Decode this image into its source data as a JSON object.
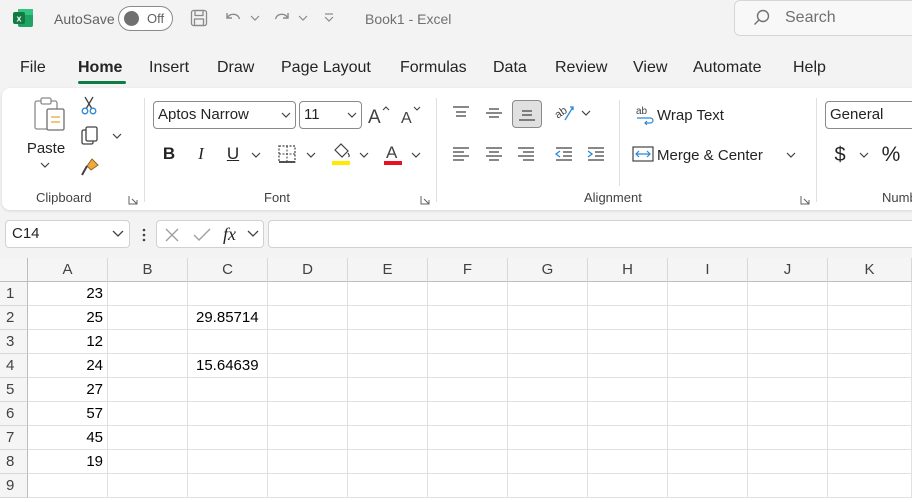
{
  "titlebar": {
    "autosave_label": "AutoSave",
    "toggle_state": "Off",
    "document_title": "Book1  -  Excel",
    "search_placeholder": "Search",
    "icons": [
      "excel-app-icon",
      "save-icon",
      "undo-icon",
      "redo-icon",
      "customize-qat-icon",
      "search-icon"
    ]
  },
  "tabs": [
    "File",
    "Home",
    "Insert",
    "Draw",
    "Page Layout",
    "Formulas",
    "Data",
    "Review",
    "View",
    "Automate",
    "Help"
  ],
  "active_tab": "Home",
  "ribbon": {
    "clipboard": {
      "label": "Clipboard",
      "paste_label": "Paste"
    },
    "font": {
      "label": "Font",
      "font_name": "Aptos Narrow",
      "font_size": "11",
      "bold": "B",
      "italic": "I",
      "underline": "U",
      "font_color": "#e81123",
      "highlight_color": "#ffeb00"
    },
    "alignment": {
      "label": "Alignment",
      "wrap_text": "Wrap Text",
      "merge_center": "Merge & Center"
    },
    "number": {
      "label": "Numb",
      "format": "General",
      "currency": "$",
      "percent": "%"
    }
  },
  "formula_bar": {
    "name_box": "C14",
    "fx": "fx",
    "formula": ""
  },
  "sheet": {
    "columns": [
      "A",
      "B",
      "C",
      "D",
      "E",
      "F",
      "G",
      "H",
      "I",
      "J",
      "K"
    ],
    "rows": [
      "1",
      "2",
      "3",
      "4",
      "5",
      "6",
      "7",
      "8",
      "9"
    ],
    "cells": {
      "A1": "23",
      "A2": "25",
      "A3": "12",
      "A4": "24",
      "A5": "27",
      "A6": "57",
      "A7": "45",
      "A8": "19",
      "C2": "29.85714",
      "C4": "15.64639"
    }
  },
  "colors": {
    "accent": "#107c41"
  }
}
